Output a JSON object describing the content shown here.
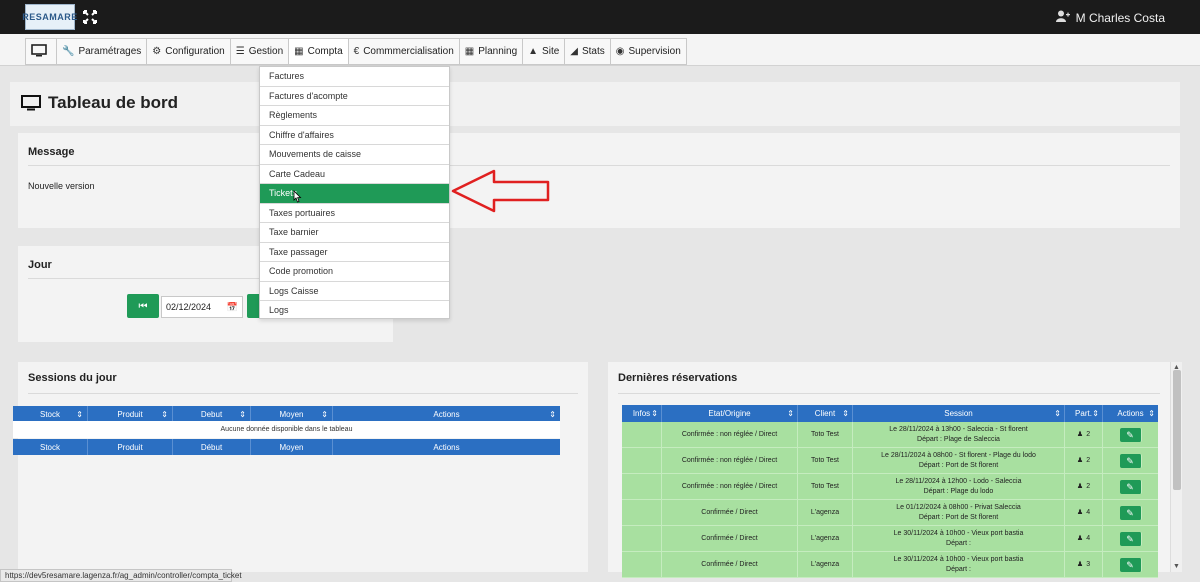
{
  "topbar": {
    "logo_text": "RESAMARE",
    "user_name": "M Charles Costa"
  },
  "menu": [
    {
      "icon": "monitor-icon",
      "label": ""
    },
    {
      "icon": "wrench-icon",
      "label": "Paramétrages"
    },
    {
      "icon": "gears-icon",
      "label": "Configuration"
    },
    {
      "icon": "list-icon",
      "label": "Gestion"
    },
    {
      "icon": "calculator-icon",
      "label": "Compta"
    },
    {
      "icon": "euro-icon",
      "label": "Commmercialisation"
    },
    {
      "icon": "calendar-icon",
      "label": "Planning"
    },
    {
      "icon": "sitemap-icon",
      "label": "Site"
    },
    {
      "icon": "area-chart-icon",
      "label": "Stats"
    },
    {
      "icon": "eye-icon",
      "label": "Supervision"
    }
  ],
  "compta_dropdown": {
    "items": [
      "Factures",
      "Factures d'acompte",
      "Règlements",
      "Chiffre d'affaires",
      "Mouvements de caisse",
      "Carte Cadeau",
      "Tickets",
      "Taxes portuaires",
      "Taxe barnier",
      "Taxe passager",
      "Code promotion",
      "Logs Caisse",
      "Logs"
    ],
    "highlighted": "Tickets"
  },
  "page": {
    "title": "Tableau de bord"
  },
  "message": {
    "title": "Message",
    "text": "Nouvelle version"
  },
  "jour": {
    "title": "Jour",
    "date": "02/12/2024"
  },
  "sessions": {
    "title": "Sessions du jour",
    "columns": [
      "Stock",
      "Produit",
      "Debut",
      "Moyen",
      "Actions"
    ],
    "footer_columns": [
      "Stock",
      "Produit",
      "Début",
      "Moyen",
      "Actions"
    ],
    "empty_text": "Aucune donnée disponible dans le tableau"
  },
  "reservations": {
    "title": "Dernières réservations",
    "columns": [
      "Infos",
      "Etat/Origine",
      "Client",
      "Session",
      "Part.",
      "Actions"
    ],
    "rows": [
      {
        "etat": "Confirmée : non réglée / Direct",
        "client": "Toto Test",
        "session1": "Le 28/11/2024 à 13h00 - Salecciа - St florent",
        "session2": "Départ : Plage de Saleccia",
        "part": "2"
      },
      {
        "etat": "Confirmée : non réglée / Direct",
        "client": "Toto Test",
        "session1": "Le 28/11/2024 à 08h00 - St florent - Plage du lodo",
        "session2": "Départ : Port de St florent",
        "part": "2"
      },
      {
        "etat": "Confirmée : non réglée / Direct",
        "client": "Toto Test",
        "session1": "Le 28/11/2024 à 12h00 - Lodo - Saleccia",
        "session2": "Départ : Plage du lodo",
        "part": "2"
      },
      {
        "etat": "Confirmée / Direct",
        "client": "L'agenza",
        "session1": "Le 01/12/2024 à 08h00 - Privat Saleccia",
        "session2": "Départ : Port de St florent",
        "part": "4"
      },
      {
        "etat": "Confirmée / Direct",
        "client": "L'agenza",
        "session1": "Le 30/11/2024 à 10h00 - Vieux port bastia",
        "session2": "Départ :",
        "part": "4"
      },
      {
        "etat": "Confirmée / Direct",
        "client": "L'agenza",
        "session1": "Le 30/11/2024 à 10h00 - Vieux port bastia",
        "session2": "Départ :",
        "part": "3"
      }
    ]
  },
  "statusbar": {
    "url": "https://dev5resamare.lagenza.fr/ag_admin/controller/compta_ticket"
  },
  "colors": {
    "primary_blue": "#2b6fc2",
    "success_green": "#1f9a57",
    "row_green": "#a8e0a0",
    "arrow_red": "#e02020",
    "topbar_dark": "#1b1b1b"
  }
}
